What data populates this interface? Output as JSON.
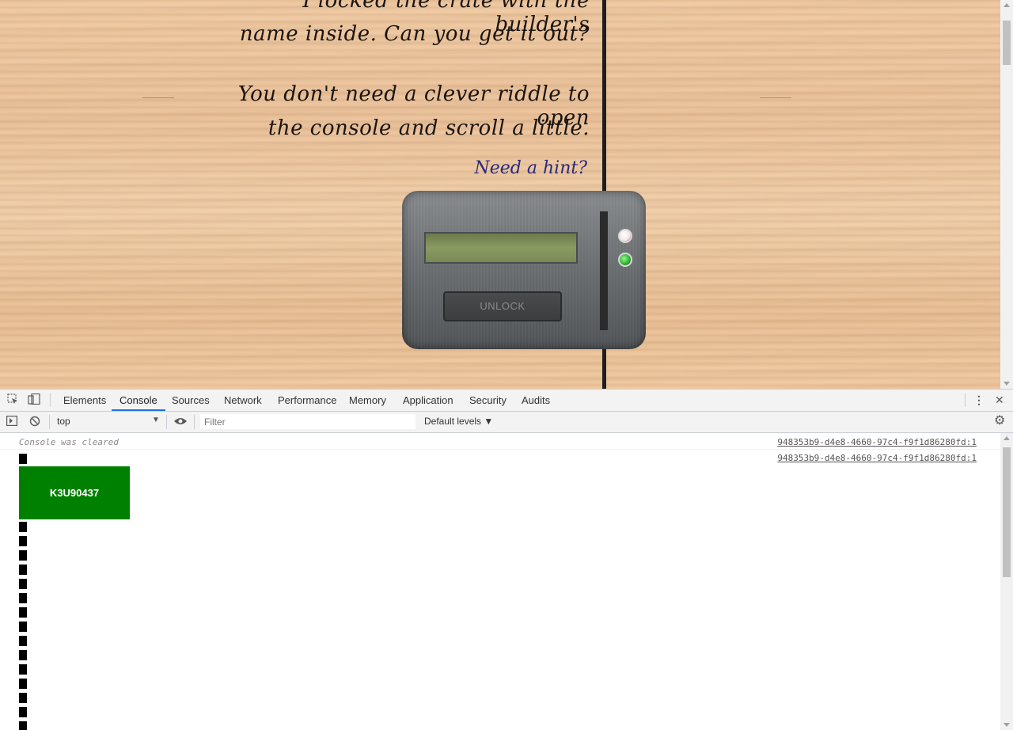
{
  "page": {
    "story_lines": [
      "I locked the crate with the builder's",
      "name inside. Can you get it out?",
      "You don't need a clever riddle to open",
      "the console and scroll a little."
    ],
    "hint_link": "Need a hint?",
    "lock": {
      "button_label": "UNLOCK",
      "lcd_text": ""
    }
  },
  "devtools": {
    "tabs": [
      "Elements",
      "Console",
      "Sources",
      "Network",
      "Performance",
      "Memory",
      "Application",
      "Security",
      "Audits"
    ],
    "active_tab": "Console",
    "toolbar": {
      "context": "top",
      "filter_placeholder": "Filter",
      "filter_value": "",
      "levels": "Default levels ▼"
    },
    "console": {
      "cleared_text": "Console was cleared",
      "source": "948353b9-d4e8-4660-97c4-f9f1d86280fd:1",
      "green_box_text": "K3U90437"
    }
  },
  "colors": {
    "accent": "#1a73e8",
    "green_box": "#008000",
    "wood": "#efcaa3"
  },
  "icons": [
    "inspect-icon",
    "device-toolbar-icon",
    "more-icon",
    "close-icon",
    "sidebar-toggle-icon",
    "clear-console-icon",
    "eye-icon",
    "settings-icon"
  ]
}
